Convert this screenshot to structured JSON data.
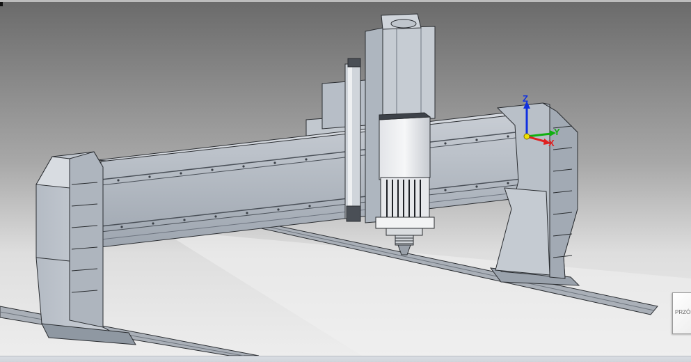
{
  "view_cube": {
    "face_label": "PRZÓD"
  },
  "triad": {
    "x_label": "X",
    "y_label": "Y",
    "z_label": "Z",
    "colors": {
      "x": "#e02020",
      "y": "#10b010",
      "z": "#1030e0",
      "origin": "#f0e000"
    }
  },
  "colors": {
    "background_top": "#6f6f6f",
    "background_bottom": "#e8e8e8",
    "metal_light": "#c8cdd4",
    "metal_mid": "#a9b0b9",
    "metal_dark": "#7f8792",
    "outline": "#2a2d31"
  }
}
